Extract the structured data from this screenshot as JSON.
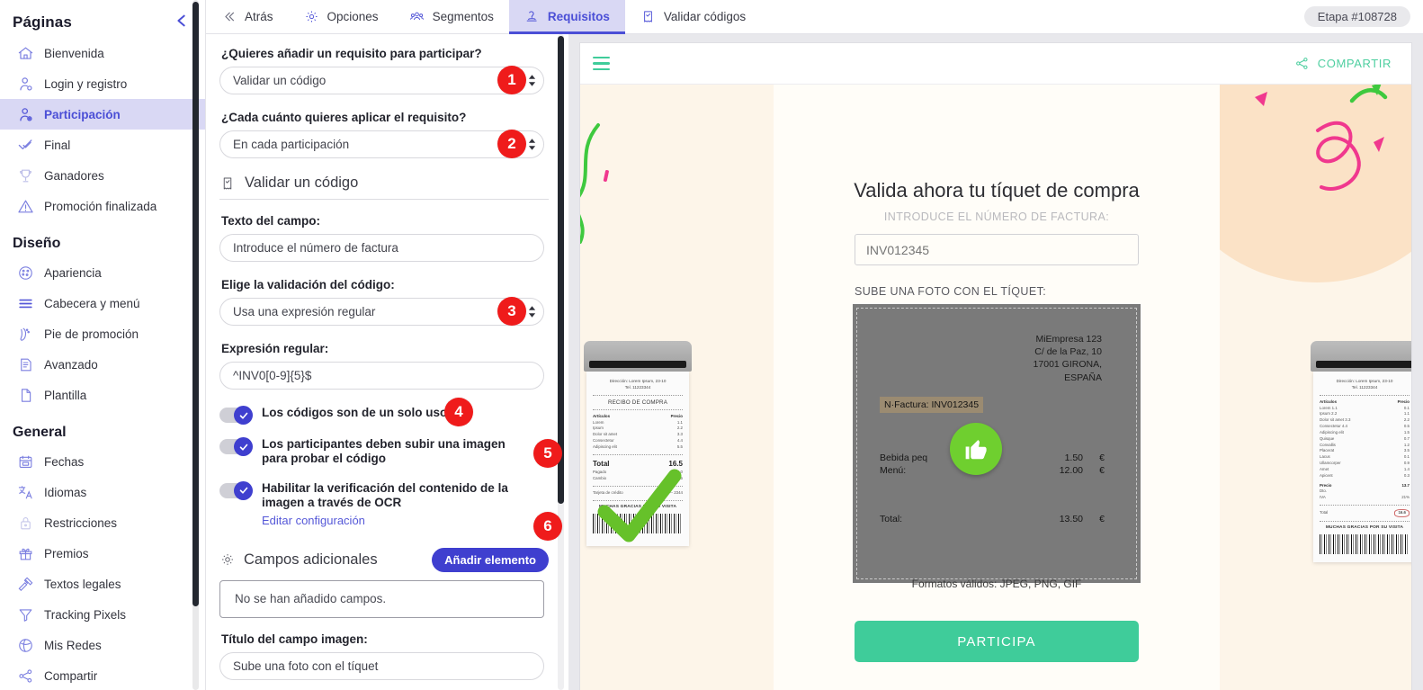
{
  "sidebar": {
    "title": "Páginas",
    "collapse_icon": "chevron-left-icon",
    "groups": [
      {
        "title": null,
        "items": [
          {
            "label": "Bienvenida",
            "icon": "home-icon",
            "active": false
          },
          {
            "label": "Login y registro",
            "icon": "user-login-icon",
            "active": false
          },
          {
            "label": "Participación",
            "icon": "user-plus-icon",
            "active": true
          },
          {
            "label": "Final",
            "icon": "check-icon",
            "active": false
          },
          {
            "label": "Ganadores",
            "icon": "trophy-icon",
            "active": false
          },
          {
            "label": "Promoción finalizada",
            "icon": "warning-icon",
            "active": false
          }
        ]
      },
      {
        "title": "Diseño",
        "items": [
          {
            "label": "Apariencia",
            "icon": "palette-icon",
            "active": false
          },
          {
            "label": "Cabecera y menú",
            "icon": "menu-lines-icon",
            "active": false
          },
          {
            "label": "Pie de promoción",
            "icon": "footer-icon",
            "active": false
          },
          {
            "label": "Avanzado",
            "icon": "document-code-icon",
            "active": false
          },
          {
            "label": "Plantilla",
            "icon": "page-icon",
            "active": false
          }
        ]
      },
      {
        "title": "General",
        "items": [
          {
            "label": "Fechas",
            "icon": "calendar-icon",
            "active": false
          },
          {
            "label": "Idiomas",
            "icon": "translate-icon",
            "active": false
          },
          {
            "label": "Restricciones",
            "icon": "lock-icon",
            "active": false
          },
          {
            "label": "Premios",
            "icon": "gift-icon",
            "active": false
          },
          {
            "label": "Textos legales",
            "icon": "gavel-icon",
            "active": false
          },
          {
            "label": "Tracking Pixels",
            "icon": "funnel-icon",
            "active": false
          },
          {
            "label": "Mis Redes",
            "icon": "network-globe-icon",
            "active": false
          },
          {
            "label": "Compartir",
            "icon": "share-icon",
            "active": false
          }
        ]
      }
    ]
  },
  "topbar": {
    "tabs": [
      {
        "label": "Atrás",
        "icon": "double-chevron-left-icon",
        "active": false
      },
      {
        "label": "Opciones",
        "icon": "gear-icon",
        "active": false
      },
      {
        "label": "Segmentos",
        "icon": "people-icon",
        "active": false
      },
      {
        "label": "Requisitos",
        "icon": "stamp-icon",
        "active": true
      },
      {
        "label": "Validar códigos",
        "icon": "ticket-check-icon",
        "active": false
      }
    ],
    "stage_badge": "Etapa #108728"
  },
  "form": {
    "question_1_label": "¿Quieres añadir un requisito para participar?",
    "question_1_value": "Validar un código",
    "badge_1": "1",
    "question_2_label": "¿Cada cuánto quieres aplicar el requisito?",
    "question_2_value": "En cada participación",
    "badge_2": "2",
    "section_title": "Validar un código",
    "section_icon": "ticket-check-icon",
    "field_text_label": "Texto del campo:",
    "field_text_value": "Introduce el número de factura",
    "validation_label": "Elige la validación del código:",
    "validation_value": "Usa una expresión regular",
    "badge_3": "3",
    "regex_label": "Expresión regular:",
    "regex_value": "^INV0[0-9]{5}$",
    "toggle_1_label": "Los códigos son de un solo uso",
    "toggle_1_on": true,
    "badge_4": "4",
    "toggle_2_label": "Los participantes deben subir una imagen para probar el código",
    "toggle_2_on": true,
    "badge_5": "5",
    "toggle_3_label": "Habilitar la verificación del contenido de la imagen a través de OCR",
    "toggle_3_link": "Editar configuración",
    "toggle_3_on": true,
    "badge_6": "6",
    "campos_title": "Campos adicionales",
    "campos_icon": "gear-icon",
    "add_button": "Añadir elemento",
    "empty_text": "No se han añadido campos.",
    "image_title_label": "Título del campo imagen:",
    "image_title_value": "Sube una foto con el tíquet"
  },
  "preview": {
    "menu_icon": "hamburger-icon",
    "share_icon": "share-icon",
    "share_label": "COMPARTIR",
    "title": "Valida ahora tu tíquet de compra",
    "subtitle": "INTRODUCE EL NÚMERO DE FACTURA:",
    "input_placeholder": "INV012345",
    "upload_label": "SUBE UNA FOTO CON EL TÍQUET:",
    "formats_note": "Formatos válidos: JPEG, PNG, GIF",
    "submit_button": "PARTICIPA",
    "ticket": {
      "company": "MiEmpresa 123",
      "address_line": "C/ de la Paz, 10",
      "city": "17001 GIRONA,",
      "country": "ESPAÑA",
      "invoice_label": "N·Factura: INV012345",
      "badge_icon": "thumbs-up-icon",
      "lines": [
        {
          "name": "Bebida peq",
          "value": "1.50",
          "cur": "€"
        },
        {
          "name": "Menú:",
          "value": "12.00",
          "cur": "€"
        }
      ],
      "total_name": "Total:",
      "total_value": "13.50",
      "total_cur": "€"
    },
    "left_receipt": {
      "address": "Dirección: Lorem Ipsum, 23-10",
      "phone": "Tel. 11223344",
      "heading": "RECIBO DE COMPRA",
      "col_item": "Artículos",
      "col_price": "Precio",
      "rows": [
        {
          "name": "Lorem",
          "price": "1.1"
        },
        {
          "name": "Ipsum",
          "price": "2.2"
        },
        {
          "name": "Dolor sit amet",
          "price": "3.3"
        },
        {
          "name": "Consectetur",
          "price": "4.4"
        },
        {
          "name": "Adipiscing elit",
          "price": "5.5"
        }
      ],
      "total_label": "Total",
      "total_value": "16.5",
      "paid_label": "Pagado",
      "paid_value": "20.0",
      "change_label": "Cambio",
      "change_value": "3.5",
      "card_label": "Tarjeta de crédito",
      "card_value": "---- ---- 2344",
      "thanks": "MUCHAS GRACIAS POR SU VISITA"
    },
    "right_receipt": {
      "address": "Dirección: Lorem Ipsum, 23-10",
      "phone": "Tel. 11223344",
      "col_item": "Artículos",
      "col_price": "Precio",
      "rows": [
        {
          "name": "Lorem  1.1",
          "price": "0.1"
        },
        {
          "name": "Ipsum  2.2",
          "price": "1.1"
        },
        {
          "name": "Dolor sit amet 3.3",
          "price": "2.2"
        },
        {
          "name": "Consectetur   4.4",
          "price": "0.5"
        },
        {
          "name": "Adipiscing elit",
          "price": "1.5"
        },
        {
          "name": "Quisque",
          "price": "0.7"
        },
        {
          "name": "Convallis",
          "price": "1.2"
        },
        {
          "name": "Placerat",
          "price": "3.5"
        },
        {
          "name": "Lacus",
          "price": "0.1"
        },
        {
          "name": "Ullamcorper",
          "price": "0.9"
        },
        {
          "name": "Amet",
          "price": "1.4"
        },
        {
          "name": "Apicent",
          "price": "0.3"
        }
      ],
      "price_label": "Precio",
      "price_value": "13.7",
      "dto_label": "Dto.",
      "iva_label": "IVA",
      "iva_value": "21%",
      "total_label": "Total",
      "total_value": "16.6",
      "thanks": "MUCHAS GRACIAS POR SU VISITA"
    }
  },
  "colors": {
    "accent": "#4b4fd6",
    "badge_red": "#ef1b1b",
    "teal": "#3fcc9a",
    "sidebar_active_bg": "#d9d8f4",
    "green_badge": "#6fcf2f"
  }
}
